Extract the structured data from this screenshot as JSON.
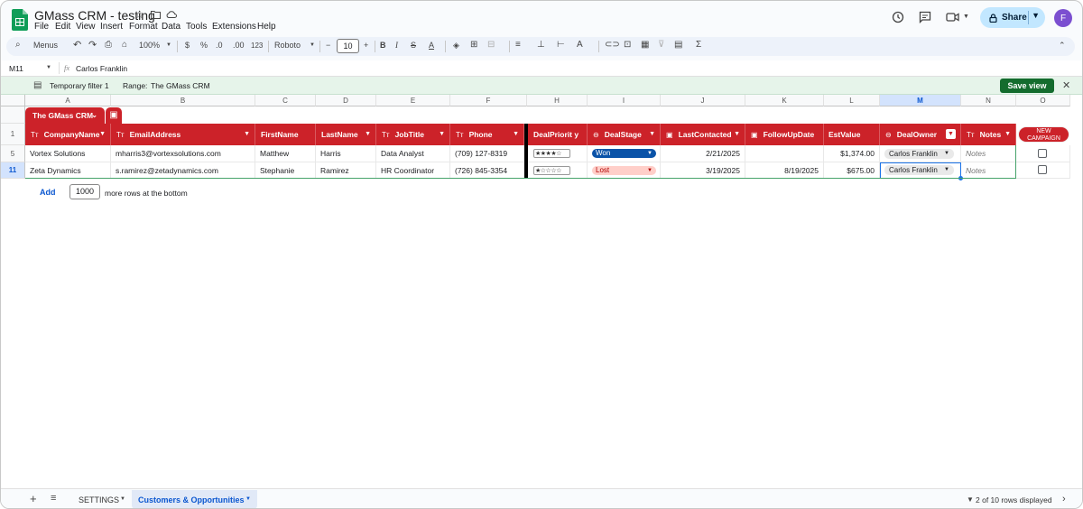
{
  "app": {
    "title": "GMass CRM - testing",
    "menus": [
      "File",
      "Edit",
      "View",
      "Insert",
      "Format",
      "Data",
      "Tools",
      "Extensions",
      "Help"
    ],
    "share_label": "Share",
    "avatar_letter": "F"
  },
  "toolbar": {
    "search_label": "Menus",
    "zoom": "100%",
    "currency": "$",
    "percent": "%",
    "dec_decrease": ".0",
    "dec_increase": ".00",
    "number_format": "123",
    "font": "Roboto",
    "font_size": "10",
    "minus": "−",
    "plus": "+"
  },
  "formula_bar": {
    "cell_ref": "M11",
    "fx": "fx",
    "value": "Carlos Franklin"
  },
  "filter_bar": {
    "filter_name": "Temporary filter 1",
    "range_label": "Range:",
    "range_value": "The GMass CRM",
    "save_label": "Save view"
  },
  "table_name": "The GMass CRM",
  "columns": [
    "A",
    "B",
    "C",
    "D",
    "E",
    "F",
    "H",
    "I",
    "J",
    "K",
    "L",
    "M",
    "N",
    "O"
  ],
  "header_row_number": "1",
  "headers": {
    "company": "CompanyName",
    "email": "EmailAddress",
    "first": "FirstName",
    "last": "LastName",
    "job": "JobTitle",
    "phone": "Phone",
    "priority": "DealPriorit y",
    "stage": "DealStage",
    "last_contacted": "LastContacted",
    "follow_up": "FollowUpDate",
    "est_value": "EstValue",
    "owner": "DealOwner",
    "notes": "Notes",
    "campaign_button": "NEW CAMPAIGN"
  },
  "type_icon": "Tт",
  "rows": [
    {
      "row_number": "5",
      "company": "Vortex Solutions",
      "email": "mharris3@vortexsolutions.com",
      "first": "Matthew",
      "last": "Harris",
      "job": "Data Analyst",
      "phone": "(709) 127-8319",
      "priority": "★★★★☆",
      "stage": "Won",
      "stage_color": "#0a53a8",
      "last_contacted": "2/21/2025",
      "follow_up": "",
      "est_value": "$1,374.00",
      "owner": "Carlos Franklin",
      "notes": "Notes"
    },
    {
      "row_number": "11",
      "company": "Zeta Dynamics",
      "email": "s.ramirez@zetadynamics.com",
      "first": "Stephanie",
      "last": "Ramirez",
      "job": "HR Coordinator",
      "phone": "(726) 845-3354",
      "priority": "★☆☆☆☆",
      "stage": "Lost",
      "stage_color": "#ffcfc9",
      "last_contacted": "3/19/2025",
      "follow_up": "8/19/2025",
      "est_value": "$675.00",
      "owner": "Carlos Franklin",
      "notes": "Notes"
    }
  ],
  "add_rows": {
    "add_label": "Add",
    "count": "1000",
    "suffix": "more rows at the bottom"
  },
  "tabs": {
    "settings": "SETTINGS",
    "active": "Customers & Opportunities",
    "status": "2 of 10 rows displayed"
  },
  "colors": {
    "header_red": "#cc2229",
    "accent_green": "#146c2e",
    "selection_blue": "#1a73e8"
  }
}
